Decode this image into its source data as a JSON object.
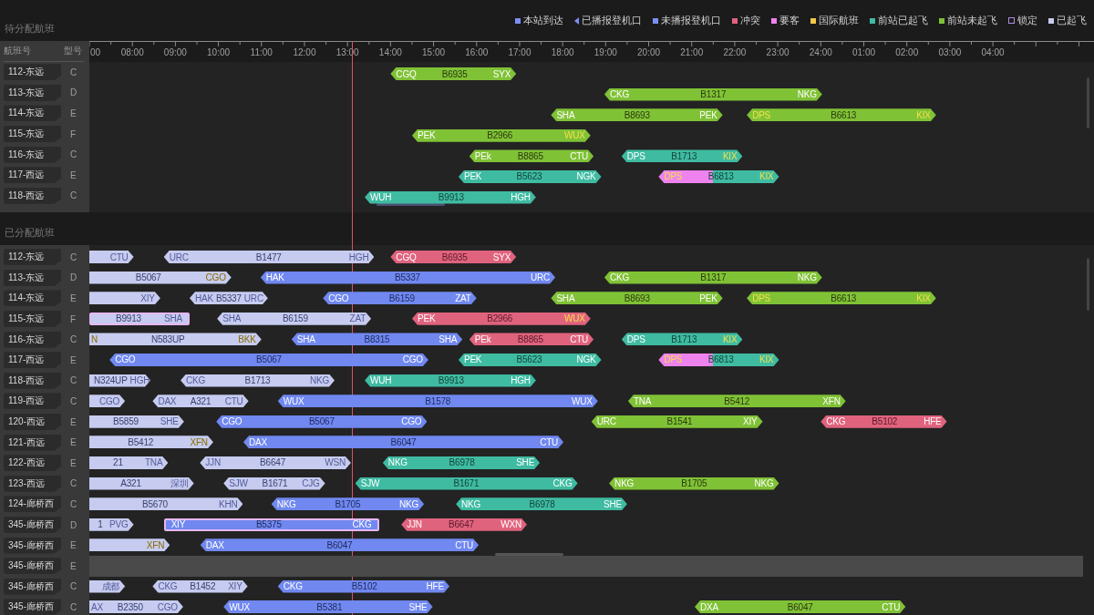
{
  "legend": [
    {
      "label": "本站到达",
      "kind": "square",
      "color": "#7c8ff5"
    },
    {
      "label": "已播报登机口",
      "kind": "triangle",
      "color": "#7c8ff5"
    },
    {
      "label": "未播报登机口",
      "kind": "square",
      "color": "#7c8ff5"
    },
    {
      "label": "冲突",
      "kind": "square",
      "color": "#e0637e"
    },
    {
      "label": "要客",
      "kind": "square",
      "color": "#ee82ee"
    },
    {
      "label": "国际航班",
      "kind": "square",
      "color": "#f3c94a"
    },
    {
      "label": "前站已起飞",
      "kind": "square",
      "color": "#3fbba2"
    },
    {
      "label": "前站未起飞",
      "kind": "square",
      "color": "#80c236"
    },
    {
      "label": "锁定",
      "kind": "hollow",
      "color": "#b08ee0"
    },
    {
      "label": "已起飞",
      "kind": "square",
      "color": "#c8ccf0"
    }
  ],
  "axis": {
    "ticks": [
      "00",
      "08:00",
      "09:00",
      "10:00",
      "11:00",
      "12:00",
      "13:00",
      "14:00",
      "15:00",
      "16:00",
      "17:00",
      "18:00",
      "19:00",
      "20:00",
      "21:00",
      "22:00",
      "23:00",
      "24:00",
      "01:00",
      "02:00",
      "03:00",
      "04:00"
    ]
  },
  "unassigned": {
    "title": "待分配航班",
    "columns": [
      "航班号",
      "型号"
    ],
    "rows": [
      {
        "slot": "112-东远",
        "type": "C",
        "bars": [
          {
            "from": "CGQ",
            "flight": "B6935",
            "to": "SYX",
            "kind": "prev-not-departed"
          }
        ]
      },
      {
        "slot": "113-东远",
        "type": "D",
        "bars": [
          {
            "from": "CKG",
            "flight": "B1317",
            "to": "NKG",
            "kind": "prev-not-departed"
          }
        ]
      },
      {
        "slot": "114-东远",
        "type": "E",
        "bars": [
          {
            "from": "SHA",
            "flight": "B8693",
            "to": "PEK",
            "kind": "prev-not-departed"
          },
          {
            "from": "DPS",
            "flight": "B6613",
            "to": "KIX",
            "kind": "prev-not-departed",
            "from_intl": true,
            "to_intl": true
          }
        ]
      },
      {
        "slot": "115-东远",
        "type": "F",
        "bars": [
          {
            "from": "PEK",
            "flight": "B2966",
            "to": "WUX",
            "kind": "prev-not-departed",
            "to_intl": true
          }
        ]
      },
      {
        "slot": "116-东远",
        "type": "C",
        "bars": [
          {
            "from": "PEk",
            "flight": "B8865",
            "to": "CTU",
            "kind": "prev-not-departed"
          },
          {
            "from": "DPS",
            "flight": "B1713",
            "to": "KIX",
            "kind": "prev-departed",
            "to_intl": true
          }
        ]
      },
      {
        "slot": "117-西远",
        "type": "E",
        "bars": [
          {
            "from": "PEK",
            "flight": "B5623",
            "to": "NGK",
            "kind": "prev-departed"
          },
          {
            "from": "DPS",
            "flight": "B6813",
            "to": "KIX",
            "kind": "vip-split",
            "from_intl": true,
            "to_intl": true
          }
        ]
      },
      {
        "slot": "118-西远",
        "type": "C",
        "bars": [
          {
            "from": "WUH",
            "flight": "B9913",
            "to": "HGH",
            "kind": "prev-departed"
          }
        ]
      }
    ]
  },
  "assigned": {
    "title": "已分配航班",
    "rows": [
      {
        "slot": "112-东远",
        "type": "C",
        "bars": [
          {
            "to": "CTU",
            "kind": "departed",
            "cut_left": true
          },
          {
            "from": "URC",
            "flight": "B1477",
            "to": "HGH",
            "kind": "departed"
          },
          {
            "from": "CGQ",
            "flight": "B6935",
            "to": "SYX",
            "kind": "conflict"
          }
        ]
      },
      {
        "slot": "113-东远",
        "type": "D",
        "bars": [
          {
            "flight": "B5067",
            "to": "CGO",
            "kind": "departed",
            "cut_left": true,
            "to_intl": true
          },
          {
            "from": "HAK",
            "flight": "B5337",
            "to": "URC",
            "kind": "arrived"
          },
          {
            "from": "CKG",
            "flight": "B1317",
            "to": "NKG",
            "kind": "prev-not-departed"
          }
        ]
      },
      {
        "slot": "114-东远",
        "type": "E",
        "bars": [
          {
            "to": "XIY",
            "kind": "departed",
            "cut_left": true
          },
          {
            "from": "HAK",
            "flight": "B5337",
            "to": "URC",
            "kind": "departed"
          },
          {
            "from": "CGO",
            "flight": "B6159",
            "to": "ZAT",
            "kind": "arrived"
          },
          {
            "from": "SHA",
            "flight": "B8693",
            "to": "PEK",
            "kind": "prev-not-departed"
          },
          {
            "from": "DPS",
            "flight": "B6613",
            "to": "KIX",
            "kind": "prev-not-departed",
            "from_intl": true,
            "to_intl": true
          }
        ]
      },
      {
        "slot": "115-东远",
        "type": "F",
        "bars": [
          {
            "flight": "B9913",
            "to": "SHA",
            "kind": "departed",
            "cut_left": true,
            "locked": true
          },
          {
            "from": "SHA",
            "flight": "B6159",
            "to": "ZAT",
            "kind": "departed"
          },
          {
            "from": "PEK",
            "flight": "B2966",
            "to": "WUX",
            "kind": "conflict",
            "to_intl": true
          }
        ]
      },
      {
        "slot": "116-东远",
        "type": "C",
        "bars": [
          {
            "from": "N",
            "flight": "N583UP",
            "to": "BKK",
            "kind": "departed",
            "cut_left": true,
            "from_intl": true,
            "to_intl": true
          },
          {
            "from": "SHA",
            "flight": "B8315",
            "to": "SHA",
            "kind": "arrived"
          },
          {
            "from": "PEk",
            "flight": "B8865",
            "to": "CTU",
            "kind": "conflict"
          },
          {
            "from": "DPS",
            "flight": "B1713",
            "to": "KIX",
            "kind": "prev-departed",
            "to_intl": true
          }
        ]
      },
      {
        "slot": "117-西远",
        "type": "E",
        "bars": [
          {
            "from": "CGO",
            "flight": "B5067",
            "to": "CGO",
            "kind": "arrived"
          },
          {
            "from": "PEK",
            "flight": "B5623",
            "to": "NGK",
            "kind": "prev-departed"
          },
          {
            "from": "DPS",
            "flight": "B6813",
            "to": "KIX",
            "kind": "vip-split",
            "from_intl": true,
            "to_intl": true
          }
        ]
      },
      {
        "slot": "118-西远",
        "type": "C",
        "bars": [
          {
            "flight": "N324UP",
            "to": "HGH",
            "kind": "departed",
            "cut_left": true
          },
          {
            "from": "CKG",
            "flight": "B1713",
            "to": "NKG",
            "kind": "departed"
          },
          {
            "from": "WUH",
            "flight": "B9913",
            "to": "HGH",
            "kind": "prev-departed"
          }
        ]
      },
      {
        "slot": "119-西远",
        "type": "C",
        "bars": [
          {
            "to": "CGO",
            "kind": "departed",
            "cut_left": true
          },
          {
            "from": "DAX",
            "flight": "A321",
            "to": "CTU",
            "kind": "departed"
          },
          {
            "from": "WUX",
            "flight": "B1578",
            "to": "WUX",
            "kind": "arrived"
          },
          {
            "from": "TNA",
            "flight": "B5412",
            "to": "XFN",
            "kind": "prev-not-departed"
          }
        ]
      },
      {
        "slot": "120-西远",
        "type": "E",
        "bars": [
          {
            "flight": "B5859",
            "to": "SHE",
            "kind": "departed",
            "cut_left": true
          },
          {
            "from": "CGO",
            "flight": "B5067",
            "to": "CGO",
            "kind": "arrived"
          },
          {
            "from": "URC",
            "flight": "B1541",
            "to": "XIY",
            "kind": "prev-not-departed"
          },
          {
            "from": "CKG",
            "flight": "B5102",
            "to": "HFE",
            "kind": "conflict"
          }
        ]
      },
      {
        "slot": "121-西远",
        "type": "E",
        "bars": [
          {
            "flight": "B5412",
            "to": "XFN",
            "kind": "departed",
            "cut_left": true,
            "to_intl": true
          },
          {
            "from": "DAX",
            "flight": "B6047",
            "to": "CTU",
            "kind": "arrived"
          }
        ]
      },
      {
        "slot": "122-西远",
        "type": "E",
        "bars": [
          {
            "flight": "21",
            "to": "TNA",
            "kind": "departed",
            "cut_left": true
          },
          {
            "from": "JJN",
            "flight": "B6647",
            "to": "WSN",
            "kind": "departed"
          },
          {
            "from": "NKG",
            "flight": "B6978",
            "to": "SHE",
            "kind": "prev-departed"
          }
        ]
      },
      {
        "slot": "123-西远",
        "type": "C",
        "bars": [
          {
            "flight": "A321",
            "to": "深圳",
            "kind": "departed",
            "cut_left": true
          },
          {
            "from": "SJW",
            "flight": "B1671",
            "to": "CJG",
            "kind": "departed"
          },
          {
            "from": "SJW",
            "flight": "B1671",
            "to": "CKG",
            "kind": "prev-departed"
          },
          {
            "from": "NKG",
            "flight": "B1705",
            "to": "NKG",
            "kind": "prev-not-departed"
          }
        ]
      },
      {
        "slot": "124-廊桥西",
        "type": "C",
        "bars": [
          {
            "flight": "B5670",
            "to": "KHN",
            "kind": "departed",
            "cut_left": true
          },
          {
            "from": "NKG",
            "flight": "B1705",
            "to": "NKG",
            "kind": "arrived"
          },
          {
            "from": "NKG",
            "flight": "B6978",
            "to": "SHE",
            "kind": "prev-departed"
          }
        ]
      },
      {
        "slot": "345-廊桥西",
        "type": "D",
        "bars": [
          {
            "flight": "1",
            "to": "PVG",
            "kind": "departed",
            "cut_left": true
          },
          {
            "from": "XIY",
            "flight": "B5375",
            "to": "CKG",
            "kind": "arrived",
            "locked": true
          },
          {
            "from": "JJN",
            "flight": "B6647",
            "to": "WXN",
            "kind": "conflict"
          }
        ]
      },
      {
        "slot": "345-廊桥西",
        "type": "E",
        "bars": [
          {
            "to": "XFN",
            "kind": "departed",
            "cut_left": true,
            "to_intl": true
          },
          {
            "from": "DAX",
            "flight": "B6047",
            "to": "CTU",
            "kind": "arrived"
          }
        ]
      },
      {
        "slot": "345-廊桥西",
        "type": "E",
        "highlighted": true,
        "bars": []
      },
      {
        "slot": "345-廊桥西",
        "type": "C",
        "bars": [
          {
            "to": "成都",
            "kind": "departed",
            "cut_left": true
          },
          {
            "from": "CKG",
            "flight": "B1452",
            "to": "XIY",
            "kind": "departed"
          },
          {
            "from": "CKG",
            "flight": "B5102",
            "to": "HFE",
            "kind": "arrived"
          }
        ]
      },
      {
        "slot": "345-廊桥西",
        "type": "C",
        "bars": [
          {
            "from": "AX",
            "flight": "B2350",
            "to": "CGO",
            "kind": "departed",
            "cut_left": true
          },
          {
            "from": "WUX",
            "flight": "B5381",
            "to": "SHE",
            "kind": "arrived"
          },
          {
            "from": "DXA",
            "flight": "B6047",
            "to": "CTU",
            "kind": "prev-not-departed"
          }
        ]
      }
    ]
  }
}
